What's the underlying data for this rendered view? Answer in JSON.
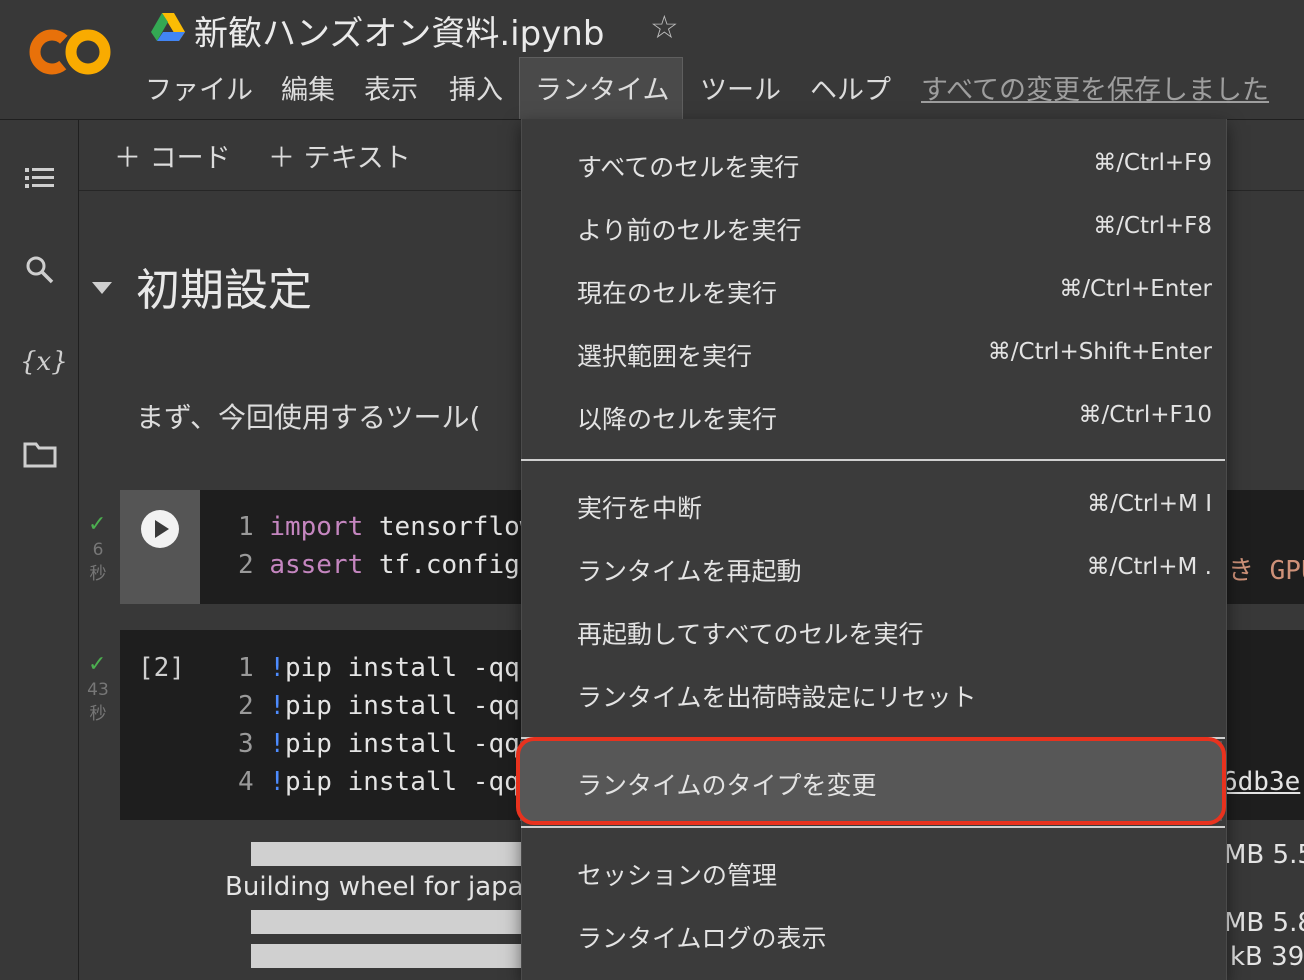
{
  "header": {
    "title": "新歓ハンズオン資料.ipynb",
    "saved_status": "すべての変更を保存しました",
    "menus": [
      "ファイル",
      "編集",
      "表示",
      "挿入",
      "ランタイム",
      "ツール",
      "ヘルプ"
    ]
  },
  "toolbar": {
    "add_code": "＋ コード",
    "add_text": "＋ テキスト"
  },
  "notebook": {
    "section_title": "初期設定",
    "intro_text": "まず、今回使用するツール(",
    "cell1": {
      "exec_time": [
        "6",
        "秒"
      ],
      "lines": [
        {
          "num": "1",
          "kw": "import",
          "rest": " tensorflow"
        },
        {
          "num": "2",
          "kw": "assert",
          "rest": " tf.config.ex"
        }
      ],
      "right_fragment": "き GPU"
    },
    "cell2": {
      "exec_count": "[2]",
      "exec_time": [
        "43",
        "秒"
      ],
      "lines": [
        {
          "num": "1",
          "bang": "!",
          "rest": "pip install -qq em"
        },
        {
          "num": "2",
          "bang": "!",
          "rest": "pip install -qq jap"
        },
        {
          "num": "3",
          "bang": "!",
          "rest": "pip install -qq jup"
        },
        {
          "num": "4",
          "bang": "!",
          "rest": "pip install -qq git"
        }
      ],
      "right_fragment": "6db3e"
    },
    "output": {
      "building_text": "Building wheel for japa",
      "right_fragments": [
        "MB 5.5",
        "MB 5.8",
        "kB 39"
      ]
    }
  },
  "runtime_menu": {
    "items": [
      {
        "label": "すべてのセルを実行",
        "shortcut": "⌘/Ctrl+F9"
      },
      {
        "label": "より前のセルを実行",
        "shortcut": "⌘/Ctrl+F8"
      },
      {
        "label": "現在のセルを実行",
        "shortcut": "⌘/Ctrl+Enter"
      },
      {
        "label": "選択範囲を実行",
        "shortcut": "⌘/Ctrl+Shift+Enter"
      },
      {
        "label": "以降のセルを実行",
        "shortcut": "⌘/Ctrl+F10"
      },
      {
        "label": "実行を中断",
        "shortcut": "⌘/Ctrl+M I"
      },
      {
        "label": "ランタイムを再起動",
        "shortcut": "⌘/Ctrl+M ."
      },
      {
        "label": "再起動してすべてのセルを実行",
        "shortcut": ""
      },
      {
        "label": "ランタイムを出荷時設定にリセット",
        "shortcut": ""
      },
      {
        "label": "ランタイムのタイプを変更",
        "shortcut": ""
      },
      {
        "label": "セッションの管理",
        "shortcut": ""
      },
      {
        "label": "ランタイムログの表示",
        "shortcut": ""
      }
    ]
  },
  "colors": {
    "highlight_ring": "#e8321e",
    "logo_orange": "#f9ab00",
    "logo_dark_orange": "#e8710a"
  }
}
